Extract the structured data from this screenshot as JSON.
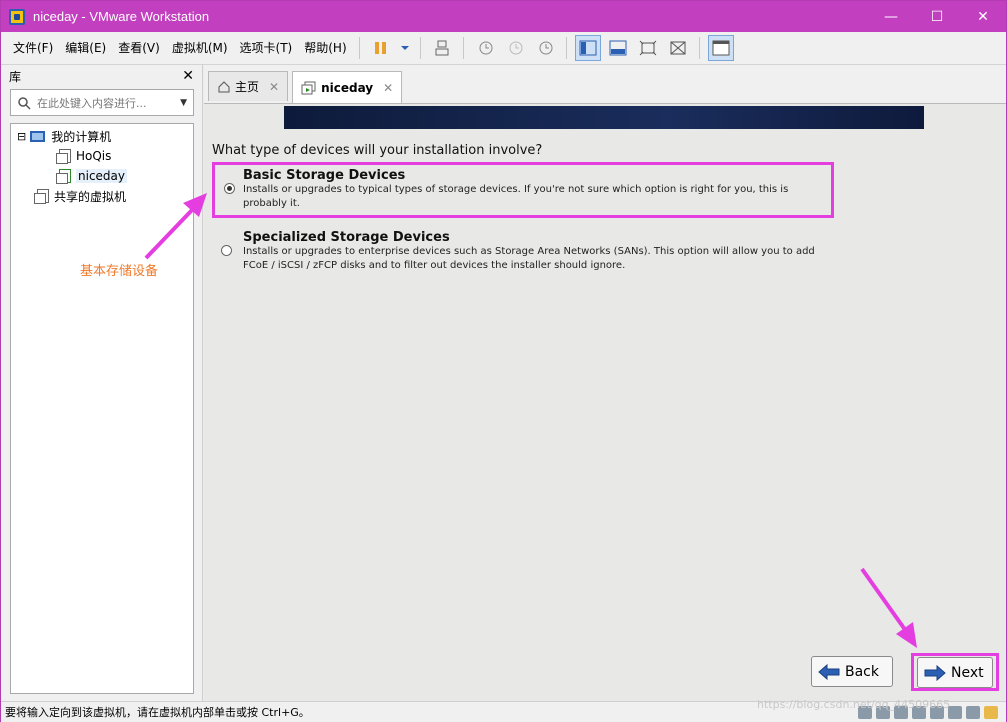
{
  "window": {
    "title": "niceday - VMware Workstation",
    "minimize_glyph": "—",
    "maximize_glyph": "☐",
    "close_glyph": "✕"
  },
  "menu": {
    "items": [
      "文件(F)",
      "编辑(E)",
      "查看(V)",
      "虚拟机(M)",
      "选项卡(T)",
      "帮助(H)"
    ]
  },
  "sidebar": {
    "title": "库",
    "close_glyph": "✕",
    "search_placeholder": "在此处键入内容进行...",
    "tree": {
      "root_expander": "⊟",
      "root_label": "我的计算机",
      "vm1_label": "HoQis",
      "vm2_label": "niceday",
      "shared_label": "共享的虚拟机"
    }
  },
  "tabs": {
    "home_label": "主页",
    "vm_label": "niceday",
    "close_glyph": "✕"
  },
  "installer": {
    "question": "What type of devices will your installation involve?",
    "basic_title": "Basic Storage Devices",
    "basic_desc": "Installs or upgrades to typical types of storage devices.  If you're not sure which option is right for you, this is probably it.",
    "specialized_title": "Specialized Storage Devices",
    "specialized_desc": "Installs or upgrades to enterprise devices such as Storage Area Networks (SANs). This option will allow you to add FCoE / iSCSI / zFCP disks and to filter out devices the installer should ignore.",
    "selected_option": "basic",
    "back_label": "Back",
    "next_label": "Next"
  },
  "annotation": {
    "text": "基本存储设备",
    "color": "#f07a2a",
    "highlight_color": "#e43ee0"
  },
  "statusbar": {
    "text": "要将输入定向到该虚拟机，请在虚拟机内部单击或按 Ctrl+G。",
    "watermark": "https://blog.csdn.net/qq_44509665"
  },
  "colors": {
    "titlebar": "#c23fbf",
    "banner": "#0d1a3a"
  }
}
